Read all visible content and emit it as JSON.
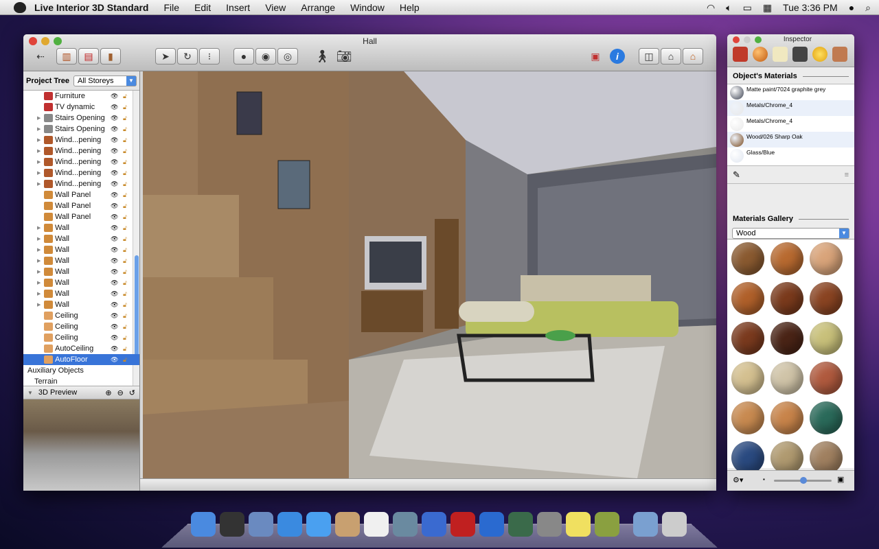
{
  "menubar": {
    "app": "Live Interior 3D Standard",
    "items": [
      "File",
      "Edit",
      "Insert",
      "View",
      "Arrange",
      "Window",
      "Help"
    ],
    "clock": "Tue 3:36 PM",
    "icons": [
      "wifi-icon",
      "volume-icon",
      "battery-icon",
      "flag-icon",
      "user-icon",
      "spotlight-icon"
    ]
  },
  "window": {
    "title": "Hall"
  },
  "project_tree": {
    "label": "Project Tree",
    "storey": "All Storeys",
    "items": [
      {
        "label": "Furniture",
        "icon": "#c03030",
        "expand": false
      },
      {
        "label": "TV dynamic",
        "icon": "#c03030",
        "expand": false
      },
      {
        "label": "Stairs Opening",
        "icon": "#888888",
        "expand": true
      },
      {
        "label": "Stairs Opening",
        "icon": "#888888",
        "expand": true
      },
      {
        "label": "Wind...pening",
        "icon": "#b0582a",
        "expand": true
      },
      {
        "label": "Wind...pening",
        "icon": "#b0582a",
        "expand": true
      },
      {
        "label": "Wind...pening",
        "icon": "#b0582a",
        "expand": true
      },
      {
        "label": "Wind...pening",
        "icon": "#b0582a",
        "expand": true
      },
      {
        "label": "Wind...pening",
        "icon": "#b0582a",
        "expand": true
      },
      {
        "label": "Wall Panel",
        "icon": "#d08a3a",
        "expand": false
      },
      {
        "label": "Wall Panel",
        "icon": "#d08a3a",
        "expand": false
      },
      {
        "label": "Wall Panel",
        "icon": "#d08a3a",
        "expand": false
      },
      {
        "label": "Wall",
        "icon": "#d08a3a",
        "expand": true
      },
      {
        "label": "Wall",
        "icon": "#d08a3a",
        "expand": true
      },
      {
        "label": "Wall",
        "icon": "#d08a3a",
        "expand": true
      },
      {
        "label": "Wall",
        "icon": "#d08a3a",
        "expand": true
      },
      {
        "label": "Wall",
        "icon": "#d08a3a",
        "expand": true
      },
      {
        "label": "Wall",
        "icon": "#d08a3a",
        "expand": true
      },
      {
        "label": "Wall",
        "icon": "#d08a3a",
        "expand": true
      },
      {
        "label": "Wall",
        "icon": "#d08a3a",
        "expand": true
      },
      {
        "label": "Ceiling",
        "icon": "#e0a060",
        "expand": false
      },
      {
        "label": "Ceiling",
        "icon": "#e0a060",
        "expand": false
      },
      {
        "label": "Ceiling",
        "icon": "#e0a060",
        "expand": false
      },
      {
        "label": "AutoCeiling",
        "icon": "#e0a060",
        "expand": false
      },
      {
        "label": "AutoFloor",
        "icon": "#e0a060",
        "expand": false,
        "selected": true
      }
    ],
    "auxiliary": "Auxiliary Objects",
    "terrain": "Terrain"
  },
  "preview": {
    "label": "3D Preview"
  },
  "inspector": {
    "title": "Inspector",
    "objects_materials": "Object's Materials",
    "materials": [
      {
        "name": "Matte paint/7024 graphite grey",
        "color": "#3a4050"
      },
      {
        "name": "Metals/Chrome_4",
        "color": "#e8e8e8"
      },
      {
        "name": "Metals/Chrome_4",
        "color": "#e8e8e8"
      },
      {
        "name": "Wood/026 Sharp Oak",
        "color": "#7a4a1e"
      },
      {
        "name": "Glass/Blue",
        "color": "#e0e6f0"
      }
    ],
    "gallery_label": "Materials Gallery",
    "gallery_category": "Wood",
    "swatches": [
      "#8a5a30",
      "#b86a30",
      "#d9a47a",
      "#b0602a",
      "#7a3a1c",
      "#8a4422",
      "#7a3a1e",
      "#4a2416",
      "#c8c07a",
      "#d4c090",
      "#d0c4a8",
      "#b05a3e",
      "#c88a50",
      "#c8844a",
      "#2a6a5a",
      "#2a4a80",
      "#b09a70",
      "#a08060"
    ]
  }
}
